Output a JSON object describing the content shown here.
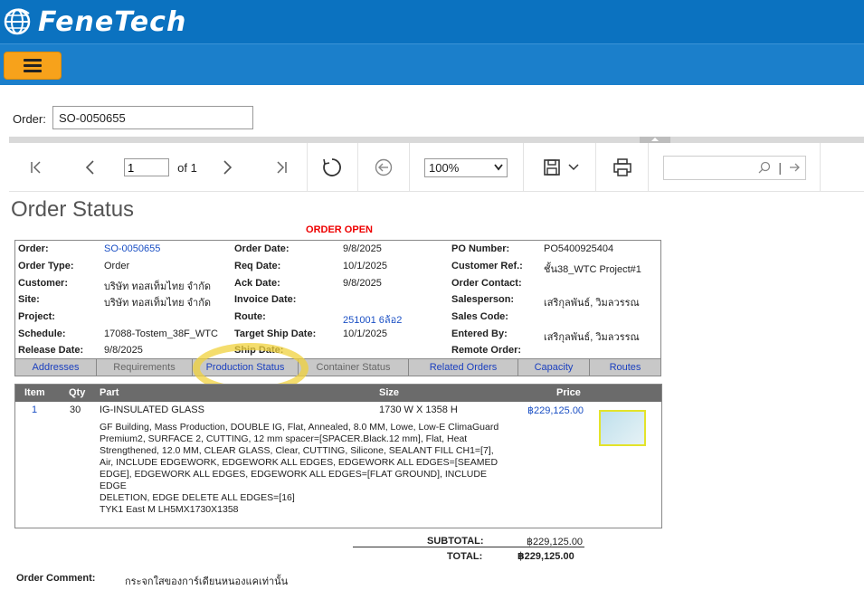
{
  "app": {
    "logo_text": "FeneTech"
  },
  "order_field": {
    "label": "Order:",
    "value": "SO-0050655"
  },
  "toolbar": {
    "page_value": "1",
    "page_of": "of 1",
    "zoom": "100%",
    "search_placeholder": ""
  },
  "report": {
    "title": "Order Status",
    "status_banner": "ORDER OPEN",
    "info": {
      "order_label": "Order:",
      "order": "SO-0050655",
      "order_type_label": "Order Type:",
      "order_type": "Order",
      "customer_label": "Customer:",
      "customer": "บริษัท ทอสเท็มไทย  จำกัด",
      "site_label": "Site:",
      "site": "บริษัท ทอสเท็มไทย  จำกัด",
      "project_label": "Project:",
      "project": "",
      "schedule_label": "Schedule:",
      "schedule": "17088-Tostem_38F_WTC",
      "release_date_label": "Release Date:",
      "release_date": "9/8/2025",
      "order_date_label": "Order Date:",
      "order_date": "9/8/2025",
      "req_date_label": "Req Date:",
      "req_date": "10/1/2025",
      "ack_date_label": "Ack Date:",
      "ack_date": "9/8/2025",
      "invoice_date_label": "Invoice Date:",
      "invoice_date": "",
      "route_label": "Route:",
      "route": "251001 6ล้อ2",
      "target_ship_label": "Target Ship Date:",
      "target_ship": "10/1/2025",
      "ship_date_label": "Ship Date:",
      "ship_date": "",
      "po_label": "PO Number:",
      "po": "PO5400925404",
      "cust_ref_label": "Customer Ref.:",
      "cust_ref": "ชั้น38_WTC Project#1",
      "order_contact_label": "Order Contact:",
      "order_contact": "",
      "salesperson_label": "Salesperson:",
      "salesperson": "เสริกุลพันธ์, วิมลวรรณ",
      "sales_code_label": "Sales Code:",
      "sales_code": "",
      "entered_by_label": "Entered By:",
      "entered_by": "เสริกุลพันธ์, วิมลวรรณ",
      "remote_order_label": "Remote Order:",
      "remote_order": ""
    },
    "tabs": [
      {
        "label": "Addresses",
        "active": true
      },
      {
        "label": "Requirements",
        "active": false
      },
      {
        "label": "Production Status",
        "active": true
      },
      {
        "label": "Container Status",
        "active": false
      },
      {
        "label": "Related Orders",
        "active": true
      },
      {
        "label": "Capacity",
        "active": true
      },
      {
        "label": "Routes",
        "active": true
      }
    ],
    "items_table": {
      "headers": [
        "Item",
        "Qty",
        "Part",
        "Size",
        "Price"
      ],
      "rows": [
        {
          "item": "1",
          "qty": "30",
          "part": "IG-INSULATED GLASS",
          "size": "1730 W X 1358 H",
          "price": "฿229,125.00",
          "description": [
            "GF Building, Mass Production, DOUBLE IG, Flat, Annealed, 8.0 MM, Lowe, Low-E ClimaGuard",
            "Premium2, SURFACE 2, CUTTING, 12 mm spacer=[SPACER.Black.12 mm], Flat, Heat",
            "Strengthened, 12.0 MM, CLEAR GLASS, Clear, CUTTING, Silicone, SEALANT FILL CH1=[7],",
            "Air, INCLUDE EDGEWORK, EDGEWORK ALL EDGES, EDGEWORK ALL EDGES=[SEAMED",
            "EDGE], EDGEWORK ALL EDGES, EDGEWORK ALL EDGES=[FLAT GROUND], INCLUDE EDGE",
            "DELETION, EDGE DELETE ALL EDGES=[16]",
            "TYK1 East M LH5MX1730X1358"
          ]
        }
      ]
    },
    "totals": {
      "subtotal_label": "SUBTOTAL:",
      "subtotal": "฿229,125.00",
      "total_label": "TOTAL:",
      "total": "฿229,125.00"
    },
    "comment": {
      "label": "Order Comment:",
      "value": "กระจกใสของการ์เดียนหนองแคเท่านั้น"
    }
  }
}
